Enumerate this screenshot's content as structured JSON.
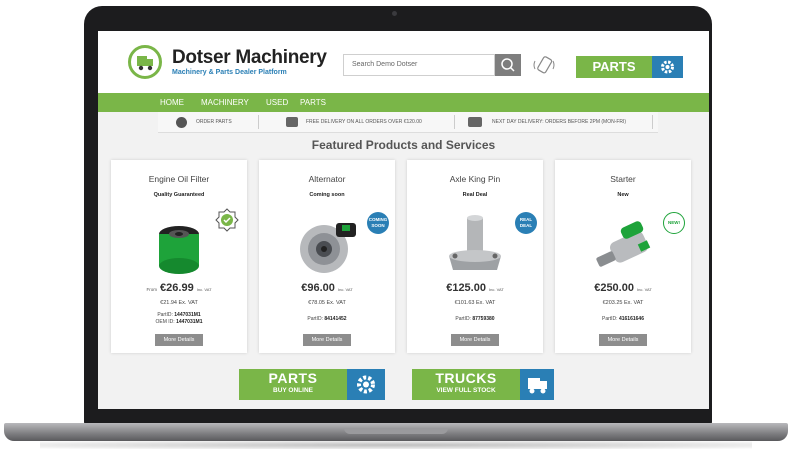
{
  "brand": {
    "name": "Dotser Machinery",
    "tagline": "Machinery & Parts Dealer Platform"
  },
  "search": {
    "placeholder": "Search Demo Dotser"
  },
  "header": {
    "parts_label": "PARTS"
  },
  "nav": {
    "items": [
      "HOME",
      "MACHINERY",
      "USED",
      "PARTS"
    ]
  },
  "info_bar": [
    "ORDER PARTS",
    "FREE DELIVERY ON ALL ORDERS OVER €120.00",
    "NEXT DAY DELIVERY: ORDERS BEFORE 2PM (MON-FRI)"
  ],
  "featured_title": "Featured Products and Services",
  "products": [
    {
      "name": "Engine Oil Filter",
      "tag": "Quality Guaranteed",
      "from": "From",
      "price": "€26.99",
      "inc": "Inc. VAT",
      "ex_vat": "€21.94 Ex. VAT",
      "part_id_label": "PartID:",
      "part_id": "1447031M1",
      "oem_label": "OEM ID:",
      "oem_id": "1447031M1",
      "more": "More Details"
    },
    {
      "name": "Alternator",
      "tag": "Coming soon",
      "badge": "COMING SOON",
      "price": "€96.00",
      "inc": "Inc. VAT",
      "ex_vat": "€78.05 Ex. VAT",
      "part_id_label": "PartID:",
      "part_id": "84141452",
      "more": "More Details"
    },
    {
      "name": "Axle King Pin",
      "tag": "Real Deal",
      "badge": "REAL DEAL",
      "price": "€125.00",
      "inc": "Inc. VAT",
      "ex_vat": "€101.63 Ex. VAT",
      "part_id_label": "PartID:",
      "part_id": "87759380",
      "more": "More Details"
    },
    {
      "name": "Starter",
      "tag": "New",
      "badge": "NEW!",
      "price": "€250.00",
      "inc": "Inc. VAT",
      "ex_vat": "€203.25 Ex. VAT",
      "part_id_label": "PartID:",
      "part_id": "416161646",
      "more": "More Details"
    }
  ],
  "cta": {
    "parts_title": "PARTS",
    "parts_sub": "BUY ONLINE",
    "trucks_title": "TRUCKS",
    "trucks_sub": "VIEW FULL STOCK"
  },
  "colors": {
    "brand_green": "#7ab648",
    "brand_blue": "#2a7fb5"
  }
}
